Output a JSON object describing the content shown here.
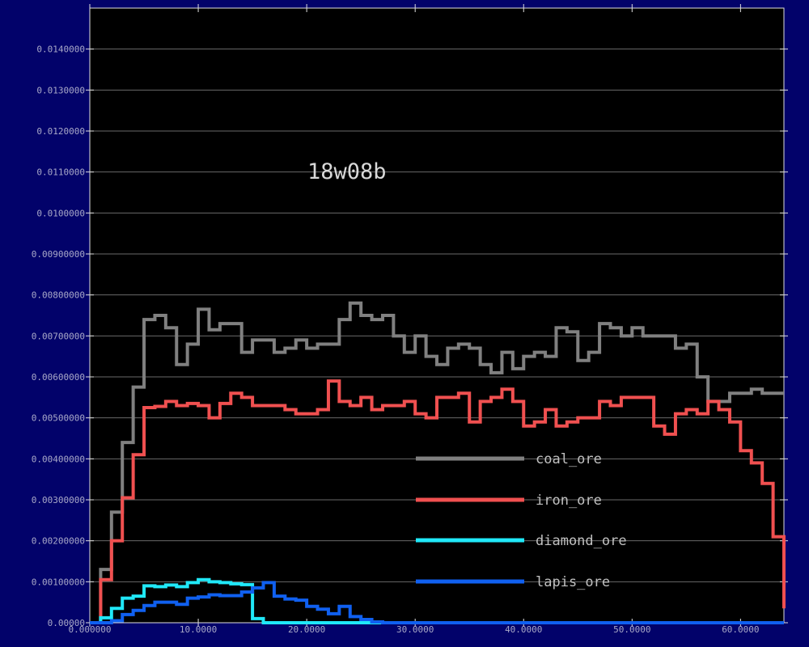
{
  "chart_data": {
    "type": "line",
    "title": "18w08b",
    "xlim": [
      0,
      64
    ],
    "ylim": [
      0,
      0.015
    ],
    "x_ticks": [
      0,
      10,
      20,
      30,
      40,
      50,
      60
    ],
    "x_tick_labels": [
      "0.000000",
      "10.0000",
      "20.0000",
      "30.0000",
      "40.0000",
      "50.0000",
      "60.0000"
    ],
    "y_ticks": [
      0,
      0.001,
      0.002,
      0.003,
      0.004,
      0.005,
      0.006,
      0.007,
      0.008,
      0.009,
      0.01,
      0.011,
      0.012,
      0.013,
      0.014
    ],
    "y_tick_labels": [
      "0.00000",
      "0.00100000",
      "0.00200000",
      "0.00300000",
      "0.00400000",
      "0.00500000",
      "0.00600000",
      "0.00700000",
      "0.00800000",
      "0.00900000",
      "0.0100000",
      "0.0110000",
      "0.0120000",
      "0.0130000",
      "0.0140000"
    ],
    "grid": true,
    "step": true,
    "legend_position": "bottom-center",
    "background_color": "#000000",
    "frame_color": "#02026a",
    "series": [
      {
        "name": "coal_ore",
        "color": "#808080",
        "x": [
          0,
          1,
          2,
          3,
          4,
          5,
          6,
          7,
          8,
          9,
          10,
          11,
          12,
          13,
          14,
          15,
          16,
          17,
          18,
          19,
          20,
          21,
          22,
          23,
          24,
          25,
          26,
          27,
          28,
          29,
          30,
          31,
          32,
          33,
          34,
          35,
          36,
          37,
          38,
          39,
          40,
          41,
          42,
          43,
          44,
          45,
          46,
          47,
          48,
          49,
          50,
          51,
          52,
          53,
          54,
          55,
          56,
          57,
          58,
          59,
          60,
          61,
          62,
          63,
          64
        ],
        "values": [
          0,
          0.0013,
          0.0027,
          0.0044,
          0.00575,
          0.0074,
          0.0075,
          0.0072,
          0.0063,
          0.0068,
          0.00765,
          0.00715,
          0.0073,
          0.0073,
          0.0066,
          0.0069,
          0.0069,
          0.0066,
          0.0067,
          0.0069,
          0.0067,
          0.0068,
          0.0068,
          0.0074,
          0.0078,
          0.0075,
          0.0074,
          0.0075,
          0.007,
          0.0066,
          0.007,
          0.0065,
          0.0063,
          0.0067,
          0.0068,
          0.0067,
          0.0063,
          0.0061,
          0.0066,
          0.0062,
          0.0065,
          0.0066,
          0.0065,
          0.0072,
          0.0071,
          0.0064,
          0.0066,
          0.0073,
          0.0072,
          0.007,
          0.0072,
          0.007,
          0.007,
          0.007,
          0.0067,
          0.0068,
          0.006,
          0.0054,
          0.0054,
          0.0056,
          0.0056,
          0.0057,
          0.0056,
          0.0056,
          0.0056
        ]
      },
      {
        "name": "iron_ore",
        "color": "#f05050",
        "x": [
          0,
          1,
          2,
          3,
          4,
          5,
          6,
          7,
          8,
          9,
          10,
          11,
          12,
          13,
          14,
          15,
          16,
          17,
          18,
          19,
          20,
          21,
          22,
          23,
          24,
          25,
          26,
          27,
          28,
          29,
          30,
          31,
          32,
          33,
          34,
          35,
          36,
          37,
          38,
          39,
          40,
          41,
          42,
          43,
          44,
          45,
          46,
          47,
          48,
          49,
          50,
          51,
          52,
          53,
          54,
          55,
          56,
          57,
          58,
          59,
          60,
          61,
          62,
          63,
          64
        ],
        "values": [
          0,
          0.00105,
          0.002,
          0.00305,
          0.0041,
          0.00525,
          0.00528,
          0.0054,
          0.0053,
          0.00535,
          0.0053,
          0.005,
          0.00535,
          0.0056,
          0.0055,
          0.0053,
          0.0053,
          0.0053,
          0.0052,
          0.0051,
          0.0051,
          0.0052,
          0.0059,
          0.0054,
          0.0053,
          0.0055,
          0.0052,
          0.0053,
          0.0053,
          0.0054,
          0.0051,
          0.005,
          0.0055,
          0.0055,
          0.0056,
          0.0049,
          0.0054,
          0.0055,
          0.0057,
          0.0054,
          0.0048,
          0.0049,
          0.0052,
          0.0048,
          0.0049,
          0.005,
          0.005,
          0.0054,
          0.0053,
          0.0055,
          0.0055,
          0.0055,
          0.0048,
          0.0046,
          0.0051,
          0.0052,
          0.0051,
          0.0054,
          0.0052,
          0.0049,
          0.0042,
          0.0039,
          0.0034,
          0.0021,
          0.00035
        ]
      },
      {
        "name": "diamond_ore",
        "color": "#20e8f8",
        "x": [
          0,
          1,
          2,
          3,
          4,
          5,
          6,
          7,
          8,
          9,
          10,
          11,
          12,
          13,
          14,
          15,
          16,
          17,
          18,
          19,
          20,
          21,
          22,
          23,
          24,
          25,
          26,
          27,
          28,
          29,
          30,
          31,
          32,
          33,
          34,
          35,
          36,
          37,
          38,
          39,
          40,
          41,
          42,
          43,
          44,
          45,
          46,
          47,
          48,
          49,
          50,
          51,
          52,
          53,
          54,
          55,
          56,
          57,
          58,
          59,
          60,
          61,
          62,
          63,
          64
        ],
        "values": [
          0,
          0.00012,
          0.00035,
          0.0006,
          0.00065,
          0.0009,
          0.00088,
          0.00092,
          0.00088,
          0.00098,
          0.00105,
          0.001,
          0.00098,
          0.00095,
          0.00093,
          0.0001,
          0,
          0,
          0,
          0,
          0,
          0,
          0,
          0,
          0,
          0,
          0,
          0,
          0,
          0,
          0,
          0,
          0,
          0,
          0,
          0,
          0,
          0,
          0,
          0,
          0,
          0,
          0,
          0,
          0,
          0,
          0,
          0,
          0,
          0,
          0,
          0,
          0,
          0,
          0,
          0,
          0,
          0,
          0,
          0,
          0,
          0,
          0,
          0,
          0
        ]
      },
      {
        "name": "lapis_ore",
        "color": "#1060f0",
        "x": [
          0,
          1,
          2,
          3,
          4,
          5,
          6,
          7,
          8,
          9,
          10,
          11,
          12,
          13,
          14,
          15,
          16,
          17,
          18,
          19,
          20,
          21,
          22,
          23,
          24,
          25,
          26,
          27,
          28,
          29,
          30,
          31,
          32,
          33,
          34,
          35,
          36,
          37,
          38,
          39,
          40,
          41,
          42,
          43,
          44,
          45,
          46,
          47,
          48,
          49,
          50,
          51,
          52,
          53,
          54,
          55,
          56,
          57,
          58,
          59,
          60,
          61,
          62,
          63,
          64
        ],
        "values": [
          0,
          0,
          5e-05,
          0.0002,
          0.0003,
          0.00042,
          0.0005,
          0.0005,
          0.00045,
          0.0006,
          0.00063,
          0.00068,
          0.00066,
          0.00066,
          0.00075,
          0.00085,
          0.00098,
          0.00065,
          0.00058,
          0.00055,
          0.0004,
          0.00033,
          0.00022,
          0.0004,
          0.00015,
          8e-05,
          2e-05,
          0,
          0,
          0,
          0,
          0,
          0,
          0,
          0,
          0,
          0,
          0,
          0,
          0,
          0,
          0,
          0,
          0,
          0,
          0,
          0,
          0,
          0,
          0,
          0,
          0,
          0,
          0,
          0,
          0,
          0,
          0,
          0,
          0,
          0,
          0,
          0,
          0,
          0
        ]
      }
    ]
  }
}
